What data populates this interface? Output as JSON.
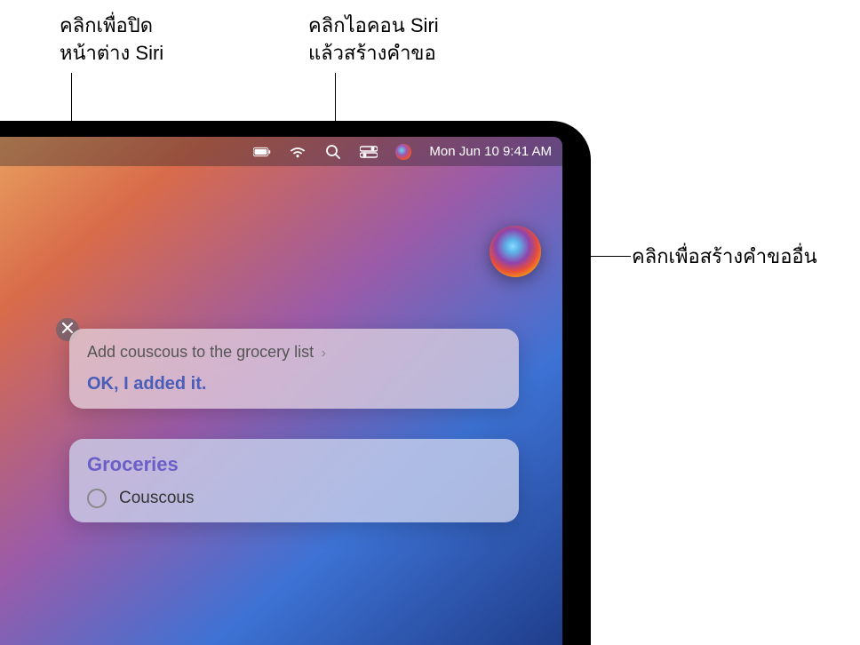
{
  "callouts": {
    "close": "คลิกเพื่อปิด\nหน้าต่าง Siri",
    "siriicon": "คลิกไอคอน Siri\nแล้วสร้างคำขอ",
    "orb": "คลิกเพื่อสร้างคำขออื่น"
  },
  "menubar": {
    "datetime": "Mon Jun 10  9:41 AM"
  },
  "siri": {
    "request": "Add couscous to the grocery list",
    "response": "OK, I added it.",
    "list_title": "Groceries",
    "list_item": "Couscous"
  }
}
